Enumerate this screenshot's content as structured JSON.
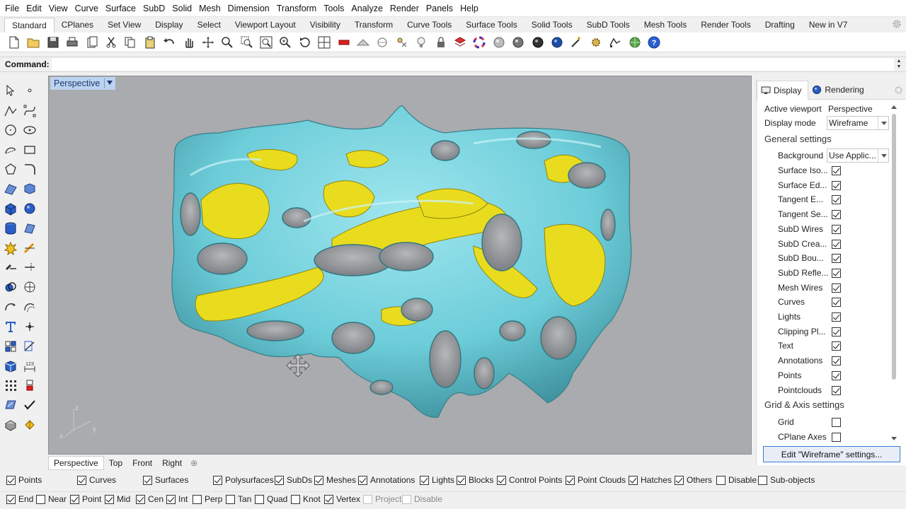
{
  "menu": [
    "File",
    "Edit",
    "View",
    "Curve",
    "Surface",
    "SubD",
    "Solid",
    "Mesh",
    "Dimension",
    "Transform",
    "Tools",
    "Analyze",
    "Render",
    "Panels",
    "Help"
  ],
  "toolbar_tabs": [
    "Standard",
    "CPlanes",
    "Set View",
    "Display",
    "Select",
    "Viewport Layout",
    "Visibility",
    "Transform",
    "Curve Tools",
    "Surface Tools",
    "Solid Tools",
    "SubD Tools",
    "Mesh Tools",
    "Render Tools",
    "Drafting",
    "New in V7"
  ],
  "active_toolbar_tab": "Standard",
  "toolbar_icons": [
    "new-file-icon",
    "open-folder-icon",
    "save-icon",
    "print-icon",
    "import-icon",
    "cut-icon",
    "copy-icon",
    "paste-icon",
    "undo-icon",
    "pan-hand-icon",
    "move-view-icon",
    "zoom-icon",
    "zoom-window-icon",
    "zoom-extents-icon",
    "zoom-selected-icon",
    "rotate-view-icon",
    "four-viewports-icon",
    "cplane-icon",
    "named-views-icon",
    "osnap-icon",
    "named-cplanes-icon",
    "lightbulb-icon",
    "lock-icon",
    "layers-icon",
    "color-wheel-icon",
    "render-sphere-icon",
    "rendered-sphere-icon",
    "material-sphere-icon",
    "blue-sphere-icon",
    "options-wand-icon",
    "gear-tools-icon",
    "grasshopper-icon",
    "globe-icon",
    "help-icon"
  ],
  "command": {
    "label": "Command:",
    "value": ""
  },
  "left_tool_icons": [
    "select-arrow-icon",
    "point-icon",
    "polyline-icon",
    "curve-icon",
    "circle-icon",
    "ellipse-icon",
    "arc-icon",
    "rectangle-icon",
    "polygon-icon",
    "fillet-curve-icon",
    "surface-corner-icon",
    "extrude-surface-icon",
    "box-icon",
    "sphere-icon",
    "cylinder-solid-icon",
    "surface-tools-icon",
    "explode-icon",
    "trim-icon",
    "join-icon",
    "split-icon",
    "boolean-icon",
    "mesh-sphere-icon",
    "curve-from-object-icon",
    "offset-icon",
    "text-icon",
    "dot-icon",
    "array-icon",
    "scale-icon",
    "box-edit-icon",
    "dimension-icon",
    "grid-points-icon",
    "block-icon",
    "analyze-surface-icon",
    "check-icon",
    "transform-object-icon",
    "render-icon"
  ],
  "viewport": {
    "title": "Perspective",
    "axes": {
      "z": "z",
      "x": "x",
      "y": "y"
    },
    "colors": {
      "background": "#a9abae",
      "outer_structure": "#6fd0dc",
      "inner_structure": "#e9dc1e"
    }
  },
  "viewport_tabs": [
    "Perspective",
    "Top",
    "Front",
    "Right"
  ],
  "panel": {
    "tabs": [
      "Display",
      "Rendering"
    ],
    "active_viewport_label": "Active viewport",
    "active_viewport_value": "Perspective",
    "display_mode_label": "Display mode",
    "display_mode_value": "Wireframe",
    "general_settings_title": "General settings",
    "background_label": "Background",
    "background_value": "Use Applic...",
    "general_items": [
      {
        "label": "Surface Iso...",
        "checked": true
      },
      {
        "label": "Surface Ed...",
        "checked": true
      },
      {
        "label": "Tangent E...",
        "checked": true
      },
      {
        "label": "Tangent Se...",
        "checked": true
      },
      {
        "label": "SubD Wires",
        "checked": true
      },
      {
        "label": "SubD Crea...",
        "checked": true
      },
      {
        "label": "SubD Bou...",
        "checked": true
      },
      {
        "label": "SubD Refle...",
        "checked": true
      },
      {
        "label": "Mesh Wires",
        "checked": true
      },
      {
        "label": "Curves",
        "checked": true
      },
      {
        "label": "Lights",
        "checked": true
      },
      {
        "label": "Clipping Pl...",
        "checked": true
      },
      {
        "label": "Text",
        "checked": true
      },
      {
        "label": "Annotations",
        "checked": true
      },
      {
        "label": "Points",
        "checked": true
      },
      {
        "label": "Pointclouds",
        "checked": true
      }
    ],
    "grid_section_title": "Grid & Axis settings",
    "grid_items": [
      {
        "label": "Grid",
        "checked": false
      },
      {
        "label": "CPlane Axes",
        "checked": false
      }
    ],
    "edit_button": "Edit \"Wireframe\" settings..."
  },
  "filter_row1": [
    {
      "label": "Points",
      "checked": true,
      "enabled": true
    },
    {
      "label": "Curves",
      "checked": true,
      "enabled": true
    },
    {
      "label": "Surfaces",
      "checked": true,
      "enabled": true
    },
    {
      "label": "Polysurfaces",
      "checked": true,
      "enabled": true
    },
    {
      "label": "SubDs",
      "checked": true,
      "enabled": true
    },
    {
      "label": "Meshes",
      "checked": true,
      "enabled": true
    },
    {
      "label": "Annotations",
      "checked": true,
      "enabled": true
    },
    {
      "label": "Lights",
      "checked": true,
      "enabled": true
    },
    {
      "label": "Blocks",
      "checked": true,
      "enabled": true
    },
    {
      "label": "Control Points",
      "checked": true,
      "enabled": true
    },
    {
      "label": "Point Clouds",
      "checked": true,
      "enabled": true
    },
    {
      "label": "Hatches",
      "checked": true,
      "enabled": true
    },
    {
      "label": "Others",
      "checked": true,
      "enabled": true
    },
    {
      "label": "Disable",
      "checked": false,
      "enabled": true
    },
    {
      "label": "Sub-objects",
      "checked": false,
      "enabled": true
    }
  ],
  "filter_row2": [
    {
      "label": "End",
      "checked": true,
      "enabled": true
    },
    {
      "label": "Near",
      "checked": false,
      "enabled": true
    },
    {
      "label": "Point",
      "checked": true,
      "enabled": true
    },
    {
      "label": "Mid",
      "checked": true,
      "enabled": true
    },
    {
      "label": "Cen",
      "checked": true,
      "enabled": true
    },
    {
      "label": "Int",
      "checked": true,
      "enabled": true
    },
    {
      "label": "Perp",
      "checked": false,
      "enabled": true
    },
    {
      "label": "Tan",
      "checked": false,
      "enabled": true
    },
    {
      "label": "Quad",
      "checked": false,
      "enabled": true
    },
    {
      "label": "Knot",
      "checked": false,
      "enabled": true
    },
    {
      "label": "Vertex",
      "checked": true,
      "enabled": true
    },
    {
      "label": "Project",
      "checked": false,
      "enabled": false
    },
    {
      "label": "Disable",
      "checked": false,
      "enabled": false
    }
  ]
}
